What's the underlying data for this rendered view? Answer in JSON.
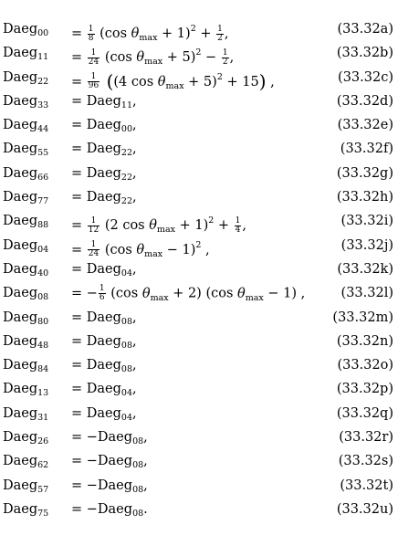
{
  "equations": [
    {
      "idx": "00",
      "tag": "(33.32a)",
      "rhs": [
        {
          "t": "frac",
          "n": "1",
          "d": "8"
        },
        {
          "t": "text",
          "v": " (cos "
        },
        {
          "t": "theta"
        },
        {
          "t": "text",
          "v": " + 1)"
        },
        {
          "t": "sup",
          "v": "2"
        },
        {
          "t": "text",
          "v": " + "
        },
        {
          "t": "frac",
          "n": "1",
          "d": "2"
        },
        {
          "t": "text",
          "v": ","
        }
      ]
    },
    {
      "idx": "11",
      "tag": "(33.32b)",
      "rhs": [
        {
          "t": "frac",
          "n": "1",
          "d": "24"
        },
        {
          "t": "text",
          "v": " (cos "
        },
        {
          "t": "theta"
        },
        {
          "t": "text",
          "v": " + 5)"
        },
        {
          "t": "sup",
          "v": "2"
        },
        {
          "t": "text",
          "v": " − "
        },
        {
          "t": "frac",
          "n": "1",
          "d": "2"
        },
        {
          "t": "text",
          "v": ","
        }
      ]
    },
    {
      "idx": "22",
      "tag": "(33.32c)",
      "rhs": [
        {
          "t": "frac",
          "n": "1",
          "d": "96"
        },
        {
          "t": "big",
          "v": " ("
        },
        {
          "t": "text",
          "v": "(4 cos "
        },
        {
          "t": "theta"
        },
        {
          "t": "text",
          "v": " + 5)"
        },
        {
          "t": "sup",
          "v": "2"
        },
        {
          "t": "text",
          "v": " + 15"
        },
        {
          "t": "big",
          "v": ")"
        },
        {
          "t": "text",
          "v": " ,"
        }
      ]
    },
    {
      "idx": "33",
      "tag": "(33.32d)",
      "rhs": [
        {
          "t": "text",
          "v": "Daeg"
        },
        {
          "t": "sub",
          "v": "11"
        },
        {
          "t": "text",
          "v": ","
        }
      ]
    },
    {
      "idx": "44",
      "tag": "(33.32e)",
      "rhs": [
        {
          "t": "text",
          "v": "Daeg"
        },
        {
          "t": "sub",
          "v": "00"
        },
        {
          "t": "text",
          "v": ","
        }
      ]
    },
    {
      "idx": "55",
      "tag": "(33.32f)",
      "rhs": [
        {
          "t": "text",
          "v": "Daeg"
        },
        {
          "t": "sub",
          "v": "22"
        },
        {
          "t": "text",
          "v": ","
        }
      ]
    },
    {
      "idx": "66",
      "tag": "(33.32g)",
      "rhs": [
        {
          "t": "text",
          "v": "Daeg"
        },
        {
          "t": "sub",
          "v": "22"
        },
        {
          "t": "text",
          "v": ","
        }
      ]
    },
    {
      "idx": "77",
      "tag": "(33.32h)",
      "rhs": [
        {
          "t": "text",
          "v": "Daeg"
        },
        {
          "t": "sub",
          "v": "22"
        },
        {
          "t": "text",
          "v": ","
        }
      ]
    },
    {
      "idx": "88",
      "tag": "(33.32i)",
      "rhs": [
        {
          "t": "frac",
          "n": "1",
          "d": "12"
        },
        {
          "t": "text",
          "v": " (2 cos "
        },
        {
          "t": "theta"
        },
        {
          "t": "text",
          "v": " + 1)"
        },
        {
          "t": "sup",
          "v": "2"
        },
        {
          "t": "text",
          "v": " + "
        },
        {
          "t": "frac",
          "n": "1",
          "d": "4"
        },
        {
          "t": "text",
          "v": ","
        }
      ]
    },
    {
      "idx": "04",
      "tag": "(33.32j)",
      "rhs": [
        {
          "t": "frac",
          "n": "1",
          "d": "24"
        },
        {
          "t": "text",
          "v": " (cos "
        },
        {
          "t": "theta"
        },
        {
          "t": "text",
          "v": " − 1)"
        },
        {
          "t": "sup",
          "v": "2"
        },
        {
          "t": "text",
          "v": " ,"
        }
      ]
    },
    {
      "idx": "40",
      "tag": "(33.32k)",
      "rhs": [
        {
          "t": "text",
          "v": "Daeg"
        },
        {
          "t": "sub",
          "v": "04"
        },
        {
          "t": "text",
          "v": ","
        }
      ]
    },
    {
      "idx": "08",
      "tag": "(33.32l)",
      "rhs": [
        {
          "t": "text",
          "v": "−"
        },
        {
          "t": "frac",
          "n": "1",
          "d": "6"
        },
        {
          "t": "text",
          "v": " (cos "
        },
        {
          "t": "theta"
        },
        {
          "t": "text",
          "v": " + 2) (cos "
        },
        {
          "t": "theta"
        },
        {
          "t": "text",
          "v": " − 1) ,"
        }
      ]
    },
    {
      "idx": "80",
      "tag": "(33.32m)",
      "rhs": [
        {
          "t": "text",
          "v": "Daeg"
        },
        {
          "t": "sub",
          "v": "08"
        },
        {
          "t": "text",
          "v": ","
        }
      ]
    },
    {
      "idx": "48",
      "tag": "(33.32n)",
      "rhs": [
        {
          "t": "text",
          "v": "Daeg"
        },
        {
          "t": "sub",
          "v": "08"
        },
        {
          "t": "text",
          "v": ","
        }
      ]
    },
    {
      "idx": "84",
      "tag": "(33.32o)",
      "rhs": [
        {
          "t": "text",
          "v": "Daeg"
        },
        {
          "t": "sub",
          "v": "08"
        },
        {
          "t": "text",
          "v": ","
        }
      ]
    },
    {
      "idx": "13",
      "tag": "(33.32p)",
      "rhs": [
        {
          "t": "text",
          "v": "Daeg"
        },
        {
          "t": "sub",
          "v": "04"
        },
        {
          "t": "text",
          "v": ","
        }
      ]
    },
    {
      "idx": "31",
      "tag": "(33.32q)",
      "rhs": [
        {
          "t": "text",
          "v": "Daeg"
        },
        {
          "t": "sub",
          "v": "04"
        },
        {
          "t": "text",
          "v": ","
        }
      ]
    },
    {
      "idx": "26",
      "tag": "(33.32r)",
      "rhs": [
        {
          "t": "text",
          "v": "−Daeg"
        },
        {
          "t": "sub",
          "v": "08"
        },
        {
          "t": "text",
          "v": ","
        }
      ]
    },
    {
      "idx": "62",
      "tag": "(33.32s)",
      "rhs": [
        {
          "t": "text",
          "v": "−Daeg"
        },
        {
          "t": "sub",
          "v": "08"
        },
        {
          "t": "text",
          "v": ","
        }
      ]
    },
    {
      "idx": "57",
      "tag": "(33.32t)",
      "rhs": [
        {
          "t": "text",
          "v": "−Daeg"
        },
        {
          "t": "sub",
          "v": "08"
        },
        {
          "t": "text",
          "v": ","
        }
      ]
    },
    {
      "idx": "75",
      "tag": "(33.32u)",
      "rhs": [
        {
          "t": "text",
          "v": "−Daeg"
        },
        {
          "t": "sub",
          "v": "08"
        },
        {
          "t": "text",
          "v": "."
        }
      ]
    }
  ]
}
